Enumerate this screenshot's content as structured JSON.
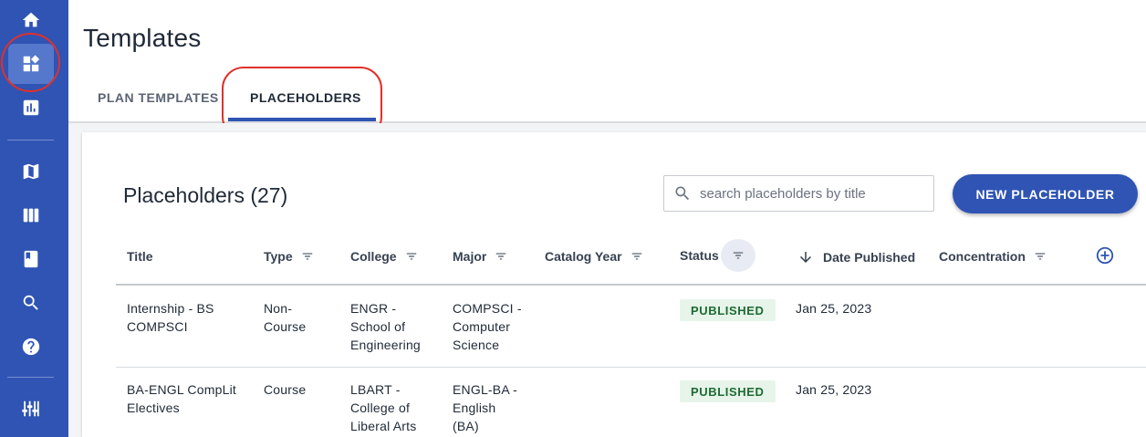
{
  "page": {
    "title": "Templates"
  },
  "tabs": [
    {
      "label": "PLAN TEMPLATES",
      "active": false
    },
    {
      "label": "PLACEHOLDERS",
      "active": true
    }
  ],
  "sidebar": {
    "items": [
      {
        "icon": "home-icon"
      },
      {
        "icon": "templates-icon",
        "active": true
      },
      {
        "icon": "bar-chart-icon"
      },
      {
        "icon": "map-icon"
      },
      {
        "icon": "columns-icon"
      },
      {
        "icon": "book-icon"
      },
      {
        "icon": "search-icon"
      },
      {
        "icon": "help-icon"
      },
      {
        "icon": "sliders-icon"
      }
    ]
  },
  "card": {
    "title": "Placeholders (27)",
    "search_placeholder": "search placeholders by title",
    "new_button": "NEW PLACEHOLDER"
  },
  "table": {
    "columns": [
      {
        "label": "Title",
        "filter": false
      },
      {
        "label": "Type",
        "filter": true
      },
      {
        "label": "College",
        "filter": true
      },
      {
        "label": "Major",
        "filter": true
      },
      {
        "label": "Catalog Year",
        "filter": true
      },
      {
        "label": "Status",
        "filter": true,
        "filter_active": true
      },
      {
        "label": "Date Published",
        "sorted": "descending"
      },
      {
        "label": "Concentration",
        "filter": true
      }
    ],
    "rows": [
      {
        "title": [
          "Internship - BS",
          "COMPSCI"
        ],
        "type": [
          "Non-",
          "Course"
        ],
        "college": [
          "ENGR -",
          "School of",
          "Engineering"
        ],
        "major": [
          "COMPSCI -",
          "Computer",
          "Science"
        ],
        "catalog_year": "",
        "status": "PUBLISHED",
        "date_published": "Jan 25, 2023",
        "concentration": ""
      },
      {
        "title": [
          "BA-ENGL CompLit",
          "Electives"
        ],
        "type": [
          "Course"
        ],
        "college": [
          "LBART -",
          "College of",
          "Liberal Arts"
        ],
        "major": [
          "ENGL-BA -",
          "English",
          "(BA)"
        ],
        "catalog_year": "",
        "status": "PUBLISHED",
        "date_published": "Jan 25, 2023",
        "concentration": ""
      }
    ]
  },
  "colors": {
    "sidebar": "#2f54b4",
    "accent": "#2f54b4",
    "badge_bg": "#e7f4ea",
    "badge_text": "#1d6b32",
    "highlight_ring": "#e0302a"
  }
}
